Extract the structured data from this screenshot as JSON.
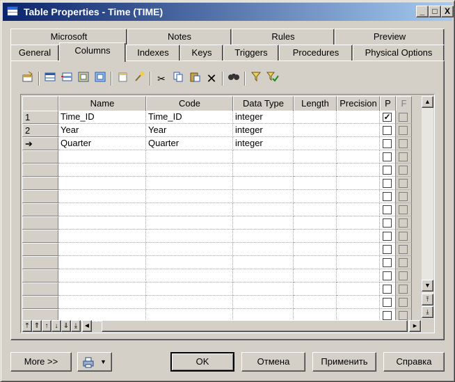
{
  "window": {
    "title": "Table Properties - Time (TIME)"
  },
  "title_buttons": {
    "minimize": "_",
    "maximize": "□",
    "close": "X"
  },
  "tabs_back": [
    {
      "label": "Microsoft"
    },
    {
      "label": "Notes"
    },
    {
      "label": "Rules"
    },
    {
      "label": "Preview"
    }
  ],
  "tabs_front": [
    {
      "label": "General"
    },
    {
      "label": "Columns",
      "active": true
    },
    {
      "label": "Indexes"
    },
    {
      "label": "Keys"
    },
    {
      "label": "Triggers"
    },
    {
      "label": "Procedures"
    },
    {
      "label": "Physical Options"
    }
  ],
  "toolbar_icons": [
    "properties-icon",
    "add-row-icon",
    "insert-row-icon",
    "add-columns-icon",
    "remove-columns-icon",
    "new-icon",
    "wand-icon",
    "cut-icon",
    "copy-icon",
    "paste-icon",
    "delete-icon",
    "find-icon",
    "filter-icon",
    "filter-apply-icon"
  ],
  "grid": {
    "columns": [
      "Name",
      "Code",
      "Data Type",
      "Length",
      "Precision",
      "P",
      "F"
    ],
    "rows": [
      {
        "header": "1",
        "name": "Time_ID",
        "code": "Time_ID",
        "data_type": "integer",
        "length": "",
        "precision": "",
        "p": true,
        "f": false
      },
      {
        "header": "2",
        "name": "Year",
        "code": "Year",
        "data_type": "integer",
        "length": "",
        "precision": "",
        "p": false,
        "f": false
      },
      {
        "header": "➔",
        "name": "Quarter",
        "code": "Quarter",
        "data_type": "integer",
        "length": "",
        "precision": "",
        "p": false,
        "f": false
      }
    ]
  },
  "buttons": {
    "more": "More >>",
    "ok": "OK",
    "cancel": "Отмена",
    "apply": "Применить",
    "help": "Справка"
  }
}
